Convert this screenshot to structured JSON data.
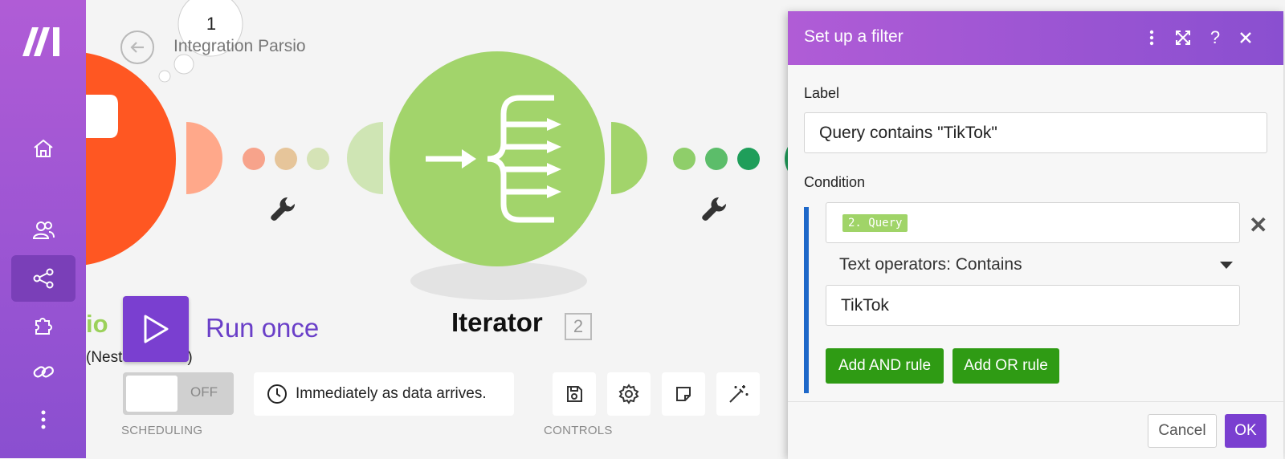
{
  "scenario": {
    "operations_count": "1",
    "title": "Integration Parsio"
  },
  "modules": {
    "left": {
      "label_visible": "io",
      "subtitle": "(Nested Tables)",
      "color": "#ff5722"
    },
    "iterator": {
      "label": "Iterator",
      "number": "2",
      "color": "#a2d46b"
    }
  },
  "run": {
    "label": "Run once"
  },
  "scheduling": {
    "toggle_state": "OFF",
    "schedule_text": "Immediately as data arrives.",
    "caption": "SCHEDULING"
  },
  "controls": {
    "caption": "CONTROLS",
    "buttons": [
      "save-icon",
      "gear-icon",
      "note-icon",
      "magic-wand-icon"
    ]
  },
  "sidebar": {
    "items": [
      "home-icon",
      "users-icon",
      "share-icon",
      "puzzle-icon",
      "link-icon",
      "more-icon"
    ],
    "active": "share-icon"
  },
  "filter_panel": {
    "title": "Set up a filter",
    "label_field_label": "Label",
    "label_value": "Query contains \"TikTok\"",
    "condition_label": "Condition",
    "condition": {
      "field_pill": "2. Query",
      "operator": "Text operators: Contains",
      "value": "TikTok"
    },
    "add_and_label": "Add AND rule",
    "add_or_label": "Add OR rule",
    "cancel_label": "Cancel",
    "ok_label": "OK",
    "header_icons": [
      "more-vertical-icon",
      "expand-icon",
      "help-icon",
      "close-icon"
    ]
  },
  "colors": {
    "accent": "#7a3fd0",
    "sidebar_top": "#b05cd6",
    "green_button": "#2f9b14",
    "condition_bar": "#1e68c9"
  }
}
